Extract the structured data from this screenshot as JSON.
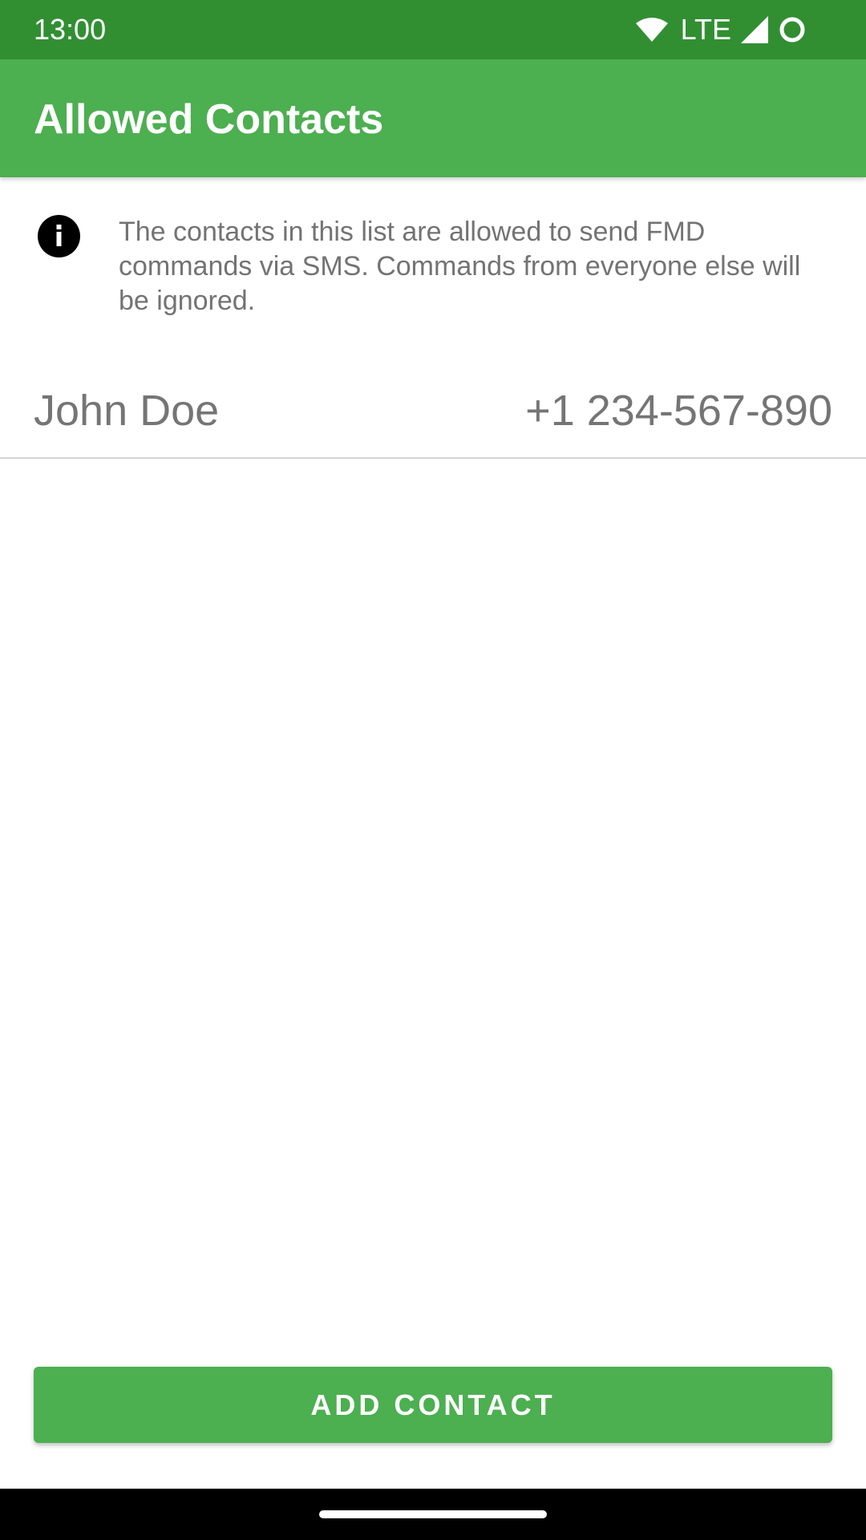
{
  "status_bar": {
    "time": "13:00",
    "network_label": "LTE",
    "icons": [
      "wifi-icon",
      "cell-signal-icon",
      "circle-status-icon"
    ]
  },
  "app_bar": {
    "title": "Allowed Contacts"
  },
  "info": {
    "icon": "info-icon",
    "text": "The contacts in this list are allowed to send FMD commands via SMS. Commands from everyone else will be ignored."
  },
  "contacts": [
    {
      "name": "John Doe",
      "phone": "+1 234-567-890"
    }
  ],
  "actions": {
    "add_contact_label": "ADD CONTACT"
  },
  "colors": {
    "status_bar": "#318f32",
    "primary": "#4caf50",
    "text_secondary": "#757575",
    "nav_bar": "#000000"
  }
}
